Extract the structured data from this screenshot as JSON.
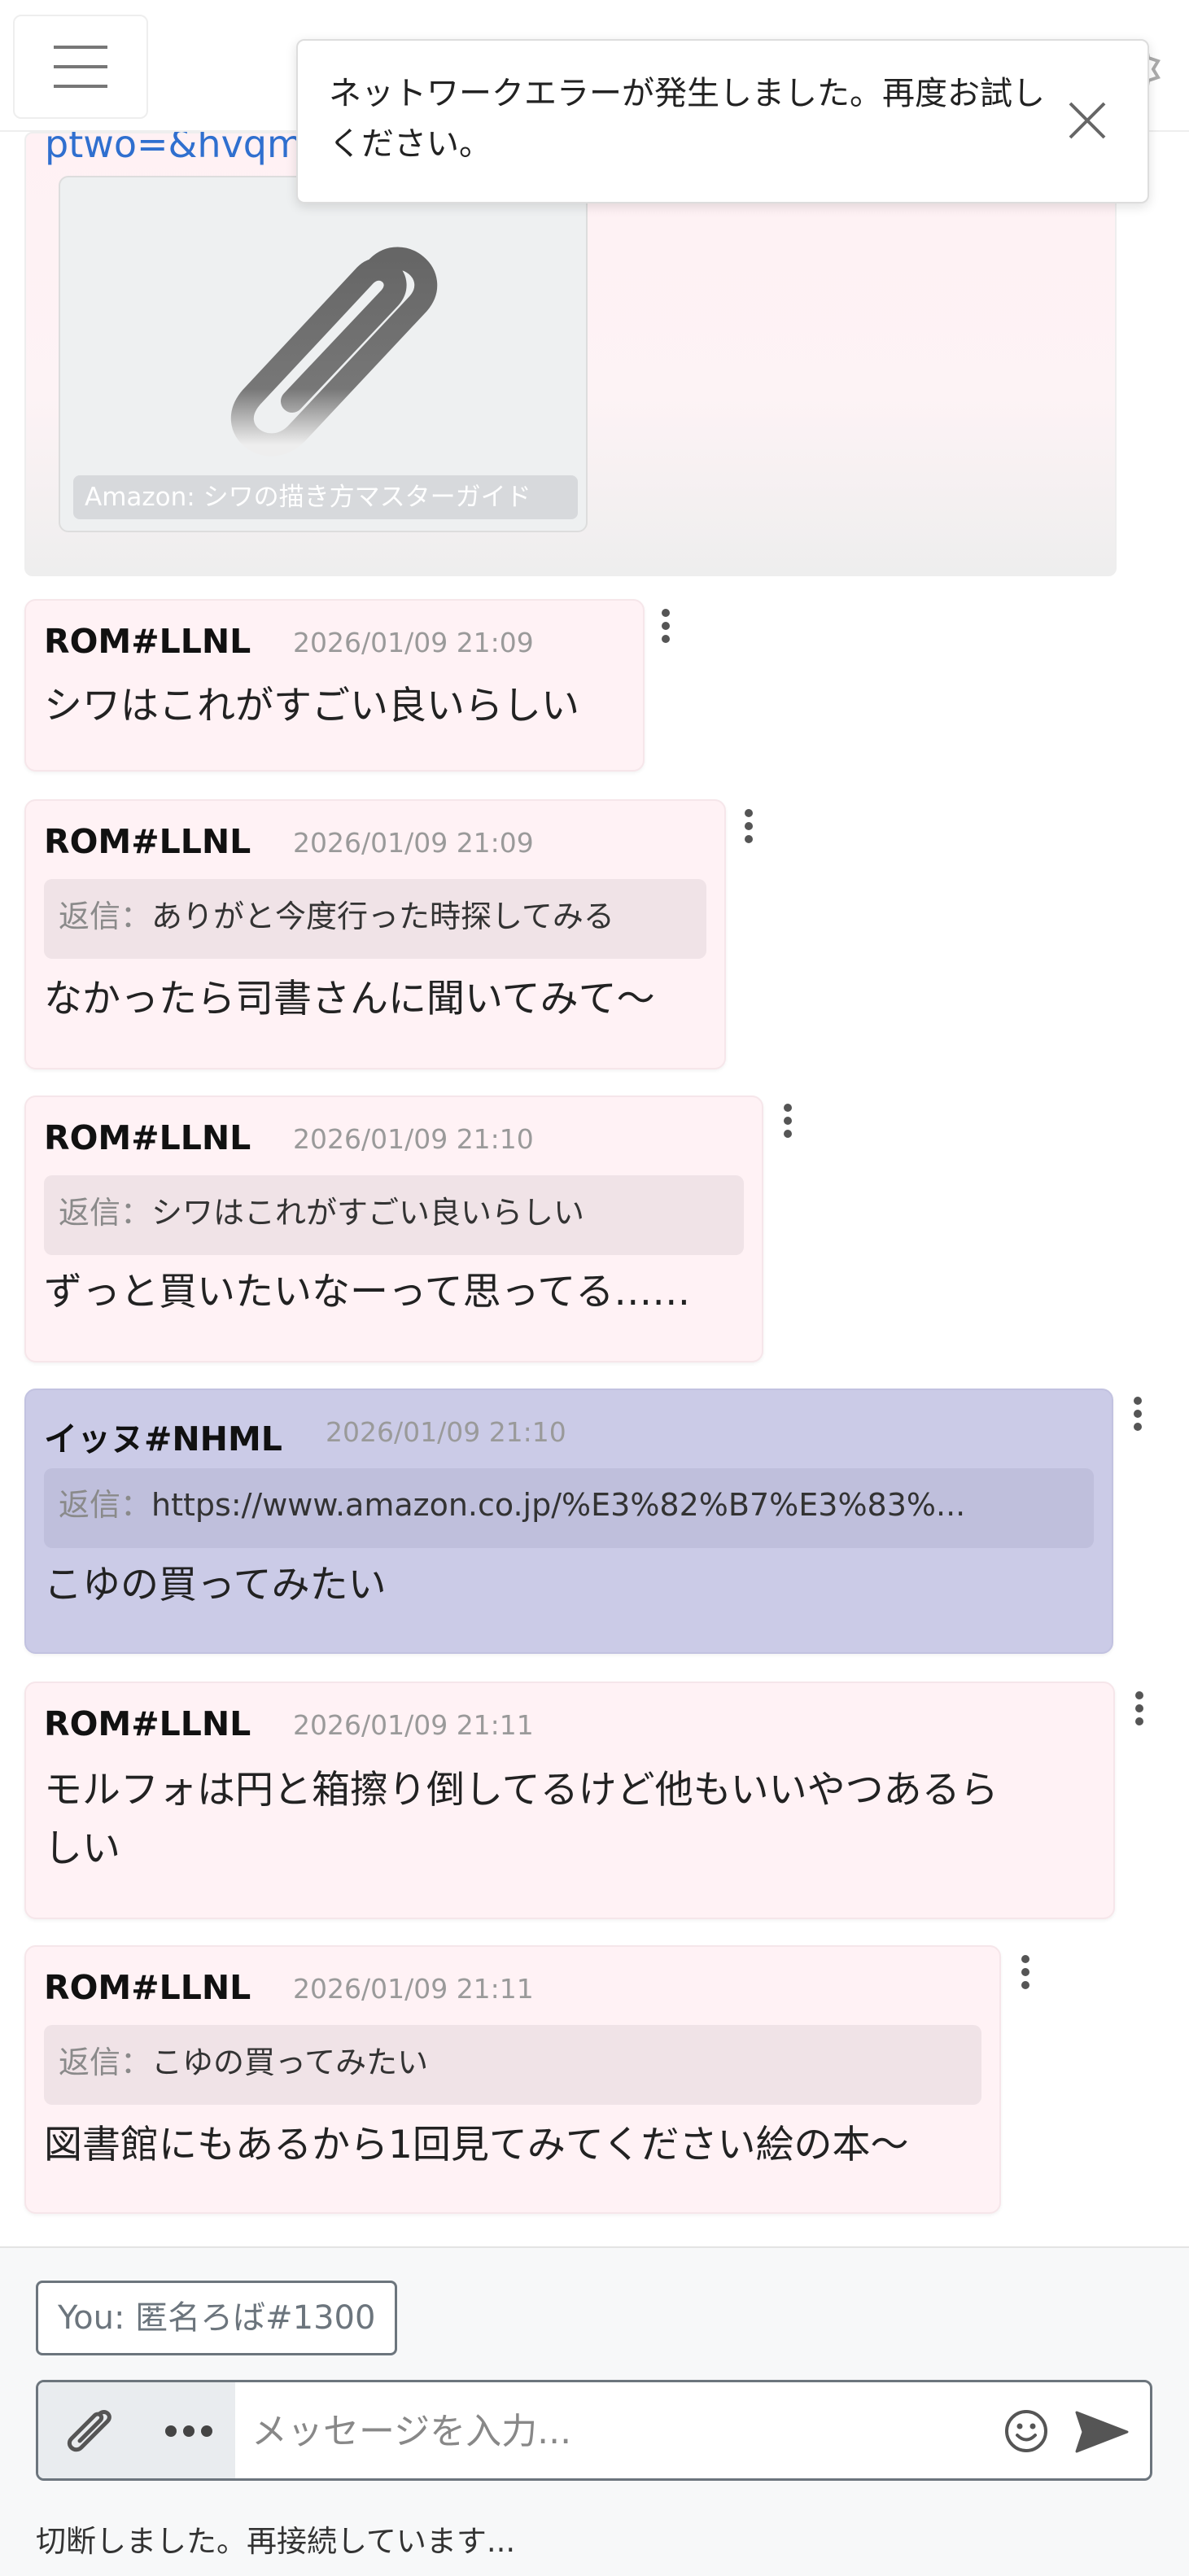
{
  "toast": {
    "message": "ネットワークエラーが発生しました。再度お試しください。"
  },
  "link_preview": {
    "url_text": "ptwo=&hvqmt=&hvdev=m&hvdvcmdl=&hvlocint",
    "caption": "Amazon: シワの描き方マスターガイド"
  },
  "messages": [
    {
      "author": "ROM#LLNL",
      "time": "2026/01/09 21:09",
      "reply_label": "",
      "reply_text": "",
      "body": "シワはこれがすごい良いらしい"
    },
    {
      "author": "ROM#LLNL",
      "time": "2026/01/09 21:09",
      "reply_label": "返信：",
      "reply_text": "ありがと今度行った時探してみる",
      "body": "なかったら司書さんに聞いてみて〜"
    },
    {
      "author": "ROM#LLNL",
      "time": "2026/01/09 21:10",
      "reply_label": "返信：",
      "reply_text": "シワはこれがすごい良いらしい",
      "body": "ずっと買いたいなーって思ってる……"
    },
    {
      "author": "イッヌ#NHML",
      "time": "2026/01/09 21:10",
      "reply_label": "返信：",
      "reply_text": "https://www.amazon.co.jp/%E3%82%B7%E3%83%...",
      "body": "こゆの買ってみたい"
    },
    {
      "author": "ROM#LLNL",
      "time": "2026/01/09 21:11",
      "reply_label": "",
      "reply_text": "",
      "body_line1": "モルフォは円と箱擦り倒してるけど他もいいやつあるら",
      "body_line2": "しい"
    },
    {
      "author": "ROM#LLNL",
      "time": "2026/01/09 21:11",
      "reply_label": "返信：",
      "reply_text": "こゆの買ってみたい",
      "body": "図書館にもあるから1回見てみてください絵の本〜"
    }
  ],
  "footer": {
    "you_label": "You: 匿名ろば#1300",
    "input_placeholder": "メッセージを入力...",
    "status": "切断しました。再接続しています..."
  },
  "colors": {
    "own_bubble": "#cbcbe7",
    "other_bubble": "#fff2f5",
    "link": "#2f6fcf",
    "muted": "#6c757d"
  },
  "icons": [
    "menu-icon",
    "bell-icon",
    "rocket-icon",
    "user-icon",
    "gear-icon",
    "close-icon",
    "paperclip-icon",
    "more-vertical-icon",
    "more-horizontal-icon",
    "emoji-icon",
    "send-icon"
  ]
}
